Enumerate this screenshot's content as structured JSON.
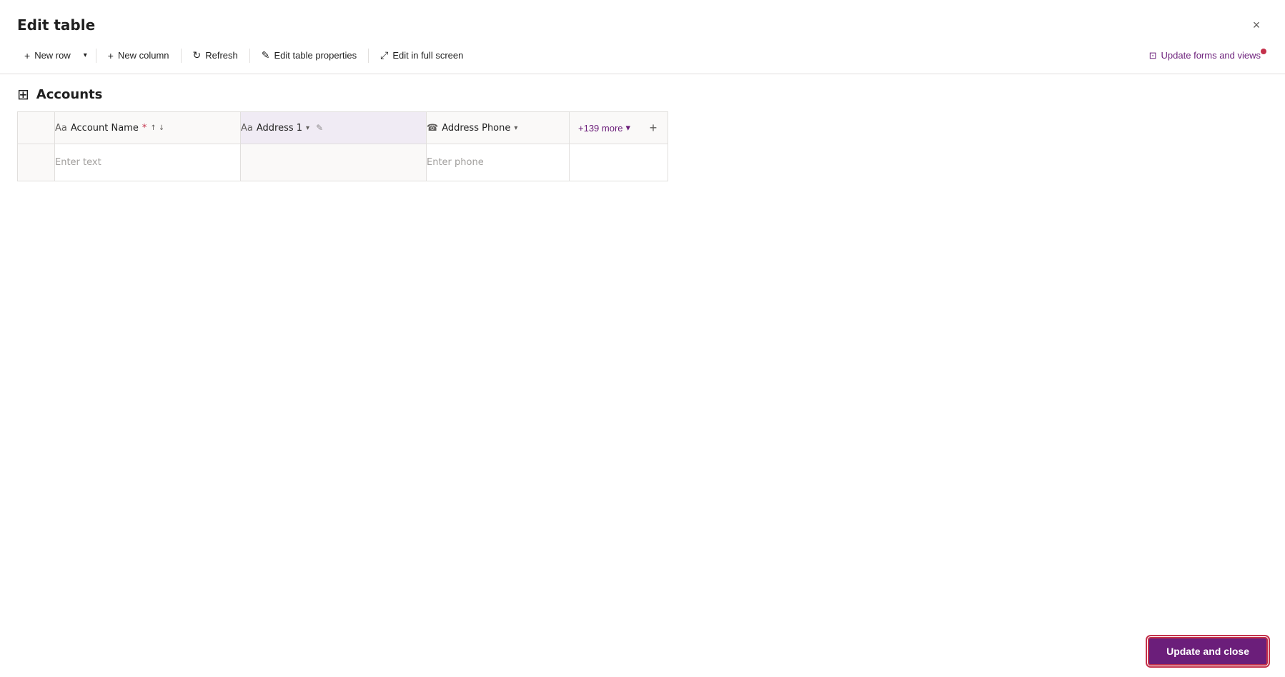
{
  "modal": {
    "title": "Edit table",
    "close_label": "×"
  },
  "toolbar": {
    "new_row_label": "New row",
    "new_row_dropdown_label": "▾",
    "new_column_label": "New column",
    "refresh_label": "Refresh",
    "edit_table_props_label": "Edit table properties",
    "edit_fullscreen_label": "Edit in full screen",
    "update_forms_label": "Update forms and views"
  },
  "table": {
    "title": "Accounts",
    "icon": "⊞"
  },
  "columns": [
    {
      "id": "row_num",
      "label": ""
    },
    {
      "id": "account_name",
      "label": "Account Name",
      "required": true,
      "icon": "Aa",
      "sort": true,
      "dropdown": true
    },
    {
      "id": "address1",
      "label": "Address 1",
      "icon": "Aa",
      "dropdown": true,
      "edit_icon": true,
      "selected": true
    },
    {
      "id": "address_phone",
      "label": "Address Phone",
      "icon": "☎",
      "dropdown": true
    }
  ],
  "more_cols": {
    "label": "+139 more",
    "dropdown": true
  },
  "add_col_label": "+",
  "rows": [
    {
      "account_name_placeholder": "Enter text",
      "address1_value": "",
      "address_phone_placeholder": "Enter phone"
    }
  ],
  "footer": {
    "update_close_label": "Update and close"
  }
}
